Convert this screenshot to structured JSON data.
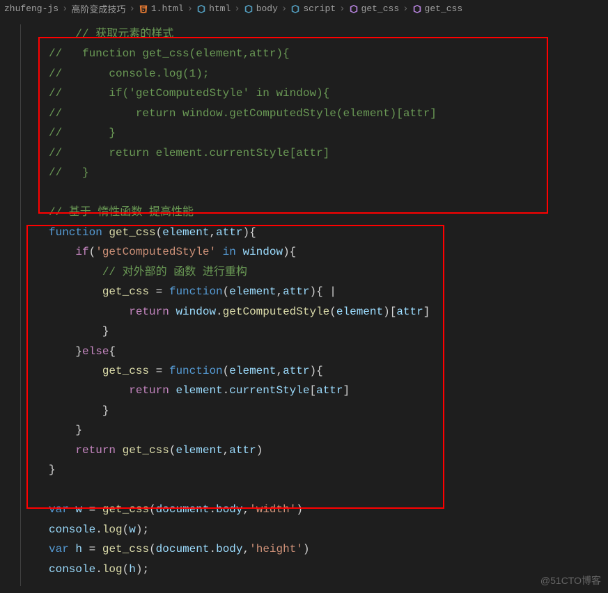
{
  "breadcrumb": {
    "items": [
      {
        "label": "zhufeng-js",
        "icon": null
      },
      {
        "label": "高阶变成技巧",
        "icon": null
      },
      {
        "label": "1.html",
        "icon": "file-html"
      },
      {
        "label": "html",
        "icon": "symbol"
      },
      {
        "label": "body",
        "icon": "symbol"
      },
      {
        "label": "script",
        "icon": "symbol"
      },
      {
        "label": "get_css",
        "icon": "symbol"
      },
      {
        "label": "get_css",
        "icon": "symbol"
      }
    ]
  },
  "code": {
    "lines": [
      {
        "indent": 2,
        "tokens": [
          {
            "t": "  // 获取元素的样式",
            "c": "c-comment"
          }
        ]
      },
      {
        "indent": 0,
        "tokens": [
          {
            "t": "//   function get_css(element,attr){",
            "c": "c-comment"
          }
        ]
      },
      {
        "indent": 0,
        "tokens": [
          {
            "t": "//       console.log(1);",
            "c": "c-comment"
          }
        ]
      },
      {
        "indent": 0,
        "tokens": [
          {
            "t": "//       if('getComputedStyle' in window){",
            "c": "c-comment"
          }
        ]
      },
      {
        "indent": 0,
        "tokens": [
          {
            "t": "//           return window.getComputedStyle(element)[attr]",
            "c": "c-comment"
          }
        ]
      },
      {
        "indent": 0,
        "tokens": [
          {
            "t": "//       }",
            "c": "c-comment"
          }
        ]
      },
      {
        "indent": 0,
        "tokens": [
          {
            "t": "//       return element.currentStyle[attr]",
            "c": "c-comment"
          }
        ]
      },
      {
        "indent": 0,
        "tokens": [
          {
            "t": "//   }",
            "c": "c-comment"
          }
        ]
      },
      {
        "indent": 0,
        "tokens": [
          {
            "t": "",
            "c": ""
          }
        ]
      },
      {
        "indent": 0,
        "tokens": [
          {
            "t": "// 基于 惰性函数 提高性能",
            "c": "c-comment"
          }
        ]
      },
      {
        "indent": 0,
        "tokens": [
          {
            "t": "function",
            "c": "c-keyword"
          },
          {
            "t": " ",
            "c": ""
          },
          {
            "t": "get_css",
            "c": "c-func"
          },
          {
            "t": "(",
            "c": "c-punc"
          },
          {
            "t": "element",
            "c": "c-var"
          },
          {
            "t": ",",
            "c": "c-punc"
          },
          {
            "t": "attr",
            "c": "c-var"
          },
          {
            "t": "){",
            "c": "c-punc"
          }
        ]
      },
      {
        "indent": 4,
        "tokens": [
          {
            "t": "if",
            "c": "c-kw2"
          },
          {
            "t": "(",
            "c": "c-punc"
          },
          {
            "t": "'getComputedStyle'",
            "c": "c-string"
          },
          {
            "t": " ",
            "c": ""
          },
          {
            "t": "in",
            "c": "c-keyword"
          },
          {
            "t": " ",
            "c": ""
          },
          {
            "t": "window",
            "c": "c-var"
          },
          {
            "t": "){",
            "c": "c-punc"
          }
        ]
      },
      {
        "indent": 8,
        "tokens": [
          {
            "t": "// 对外部的 函数 进行重构",
            "c": "c-comment"
          }
        ]
      },
      {
        "indent": 8,
        "tokens": [
          {
            "t": "get_css",
            "c": "c-func"
          },
          {
            "t": " = ",
            "c": "c-punc"
          },
          {
            "t": "function",
            "c": "c-keyword"
          },
          {
            "t": "(",
            "c": "c-punc"
          },
          {
            "t": "element",
            "c": "c-var"
          },
          {
            "t": ",",
            "c": "c-punc"
          },
          {
            "t": "attr",
            "c": "c-var"
          },
          {
            "t": "){ |",
            "c": "c-punc"
          }
        ]
      },
      {
        "indent": 12,
        "tokens": [
          {
            "t": "return",
            "c": "c-kw2"
          },
          {
            "t": " ",
            "c": ""
          },
          {
            "t": "window",
            "c": "c-var"
          },
          {
            "t": ".",
            "c": "c-punc"
          },
          {
            "t": "getComputedStyle",
            "c": "c-func"
          },
          {
            "t": "(",
            "c": "c-punc"
          },
          {
            "t": "element",
            "c": "c-var"
          },
          {
            "t": ")[",
            "c": "c-punc"
          },
          {
            "t": "attr",
            "c": "c-var"
          },
          {
            "t": "]",
            "c": "c-punc"
          }
        ]
      },
      {
        "indent": 8,
        "tokens": [
          {
            "t": "}",
            "c": "c-punc"
          }
        ]
      },
      {
        "indent": 4,
        "tokens": [
          {
            "t": "}",
            "c": "c-punc"
          },
          {
            "t": "else",
            "c": "c-kw2"
          },
          {
            "t": "{",
            "c": "c-punc"
          }
        ]
      },
      {
        "indent": 8,
        "tokens": [
          {
            "t": "get_css",
            "c": "c-func"
          },
          {
            "t": " = ",
            "c": "c-punc"
          },
          {
            "t": "function",
            "c": "c-keyword"
          },
          {
            "t": "(",
            "c": "c-punc"
          },
          {
            "t": "element",
            "c": "c-var"
          },
          {
            "t": ",",
            "c": "c-punc"
          },
          {
            "t": "attr",
            "c": "c-var"
          },
          {
            "t": "){",
            "c": "c-punc"
          }
        ]
      },
      {
        "indent": 12,
        "tokens": [
          {
            "t": "return",
            "c": "c-kw2"
          },
          {
            "t": " ",
            "c": ""
          },
          {
            "t": "element",
            "c": "c-var"
          },
          {
            "t": ".",
            "c": "c-punc"
          },
          {
            "t": "currentStyle",
            "c": "c-var"
          },
          {
            "t": "[",
            "c": "c-punc"
          },
          {
            "t": "attr",
            "c": "c-var"
          },
          {
            "t": "]",
            "c": "c-punc"
          }
        ]
      },
      {
        "indent": 8,
        "tokens": [
          {
            "t": "}",
            "c": "c-punc"
          }
        ]
      },
      {
        "indent": 4,
        "tokens": [
          {
            "t": "}",
            "c": "c-punc"
          }
        ]
      },
      {
        "indent": 4,
        "tokens": [
          {
            "t": "return",
            "c": "c-kw2"
          },
          {
            "t": " ",
            "c": ""
          },
          {
            "t": "get_css",
            "c": "c-func"
          },
          {
            "t": "(",
            "c": "c-punc"
          },
          {
            "t": "element",
            "c": "c-var"
          },
          {
            "t": ",",
            "c": "c-punc"
          },
          {
            "t": "attr",
            "c": "c-var"
          },
          {
            "t": ")",
            "c": "c-punc"
          }
        ]
      },
      {
        "indent": 0,
        "tokens": [
          {
            "t": "}",
            "c": "c-punc"
          }
        ]
      },
      {
        "indent": 0,
        "tokens": [
          {
            "t": "",
            "c": ""
          }
        ]
      },
      {
        "indent": 0,
        "tokens": [
          {
            "t": "var",
            "c": "c-keyword"
          },
          {
            "t": " ",
            "c": ""
          },
          {
            "t": "w",
            "c": "c-var"
          },
          {
            "t": " = ",
            "c": "c-punc"
          },
          {
            "t": "get_css",
            "c": "c-func"
          },
          {
            "t": "(",
            "c": "c-punc"
          },
          {
            "t": "document",
            "c": "c-var"
          },
          {
            "t": ".",
            "c": "c-punc"
          },
          {
            "t": "body",
            "c": "c-var"
          },
          {
            "t": ",",
            "c": "c-punc"
          },
          {
            "t": "'width'",
            "c": "c-string"
          },
          {
            "t": ")",
            "c": "c-punc"
          }
        ]
      },
      {
        "indent": 0,
        "tokens": [
          {
            "t": "console",
            "c": "c-var"
          },
          {
            "t": ".",
            "c": "c-punc"
          },
          {
            "t": "log",
            "c": "c-func"
          },
          {
            "t": "(",
            "c": "c-punc"
          },
          {
            "t": "w",
            "c": "c-var"
          },
          {
            "t": ");",
            "c": "c-punc"
          }
        ]
      },
      {
        "indent": 0,
        "tokens": [
          {
            "t": "var",
            "c": "c-keyword"
          },
          {
            "t": " ",
            "c": ""
          },
          {
            "t": "h",
            "c": "c-var"
          },
          {
            "t": " = ",
            "c": "c-punc"
          },
          {
            "t": "get_css",
            "c": "c-func"
          },
          {
            "t": "(",
            "c": "c-punc"
          },
          {
            "t": "document",
            "c": "c-var"
          },
          {
            "t": ".",
            "c": "c-punc"
          },
          {
            "t": "body",
            "c": "c-var"
          },
          {
            "t": ",",
            "c": "c-punc"
          },
          {
            "t": "'height'",
            "c": "c-string"
          },
          {
            "t": ")",
            "c": "c-punc"
          }
        ]
      },
      {
        "indent": 0,
        "tokens": [
          {
            "t": "console",
            "c": "c-var"
          },
          {
            "t": ".",
            "c": "c-punc"
          },
          {
            "t": "log",
            "c": "c-func"
          },
          {
            "t": "(",
            "c": "c-punc"
          },
          {
            "t": "h",
            "c": "c-var"
          },
          {
            "t": ");",
            "c": "c-punc"
          }
        ]
      }
    ]
  },
  "watermark": "@51CTO博客"
}
